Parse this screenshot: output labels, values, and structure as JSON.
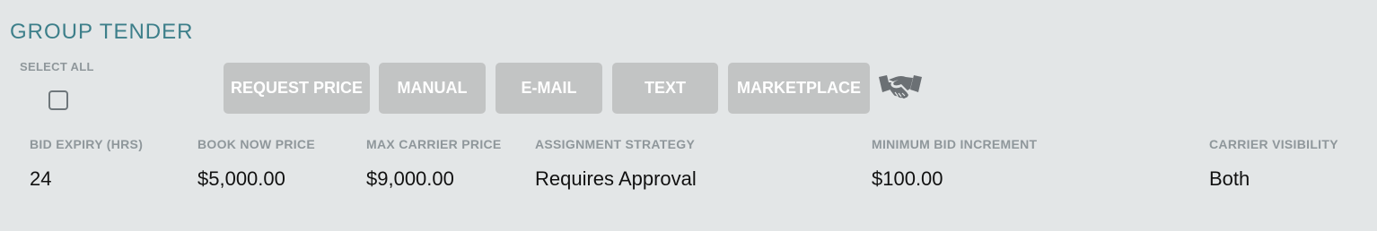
{
  "section": {
    "title": "GROUP TENDER"
  },
  "select_all": {
    "label": "SELECT ALL",
    "checked": false
  },
  "toolbar": {
    "request_price_label": "REQUEST PRICE",
    "manual_label": "MANUAL",
    "email_label": "E-MAIL",
    "text_label": "TEXT",
    "marketplace_label": "MARKETPLACE",
    "marketplace_icon": "handshake-icon",
    "button_color": "#c2c4c4"
  },
  "fields": {
    "bid_expiry": {
      "label": "BID EXPIRY (HRS)",
      "value": "24"
    },
    "book_now_price": {
      "label": "BOOK NOW PRICE",
      "value": "$5,000.00"
    },
    "max_carrier_price": {
      "label": "MAX CARRIER PRICE",
      "value": "$9,000.00"
    },
    "assignment_strategy": {
      "label": "ASSIGNMENT STRATEGY",
      "value": "Requires Approval"
    },
    "minimum_bid_increment": {
      "label": "MINIMUM BID INCREMENT",
      "value": "$100.00"
    },
    "carrier_visibility": {
      "label": "CARRIER VISIBILITY",
      "value": "Both"
    }
  },
  "colors": {
    "background": "#e3e6e7",
    "title": "#3d7f8a",
    "label": "#8f979b",
    "value": "#111111"
  }
}
